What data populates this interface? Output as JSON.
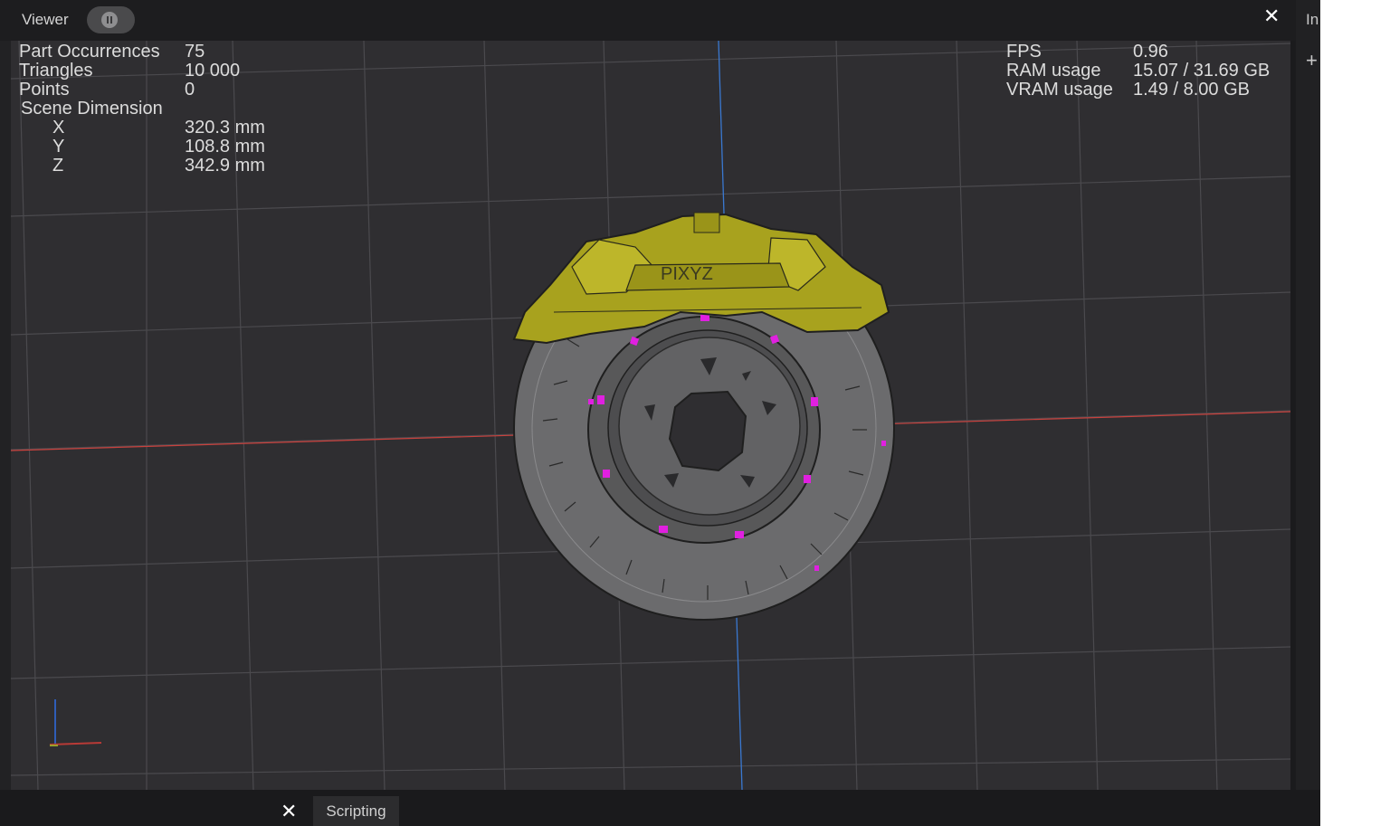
{
  "header": {
    "viewer_label": "Viewer",
    "pause_icon": "pause-icon",
    "close_icon": "close-icon"
  },
  "right_panel": {
    "label": "In",
    "plus_icon": "plus-icon"
  },
  "stats_left": {
    "part_occurrences_label": "Part Occurrences",
    "part_occurrences_value": "75",
    "triangles_label": "Triangles",
    "triangles_value": "10 000",
    "points_label": "Points",
    "points_value": "0",
    "scene_dimension_label": "Scene Dimension",
    "x_label": "X",
    "x_value": "320.3 mm",
    "y_label": "Y",
    "y_value": "108.8 mm",
    "z_label": "Z",
    "z_value": "342.9 mm"
  },
  "stats_right": {
    "fps_label": "FPS",
    "fps_value": "0.96",
    "ram_label": "RAM usage",
    "ram_value": "15.07 / 31.69 GB",
    "vram_label": "VRAM usage",
    "vram_value": "1.49 / 8.00 GB"
  },
  "model": {
    "caliper_text": "PIXYZ",
    "caliper_color": "#a8a21e",
    "disc_color": "#6a6a6c",
    "highlight_color": "#e020e0"
  },
  "bottom_bar": {
    "close_icon": "close-icon",
    "tab_label": "Scripting"
  },
  "colors": {
    "viewport_bg": "#2f2e31",
    "grid_line": "#4a4a4d",
    "x_axis": "#c8413d",
    "z_axis": "#3a78d0"
  }
}
